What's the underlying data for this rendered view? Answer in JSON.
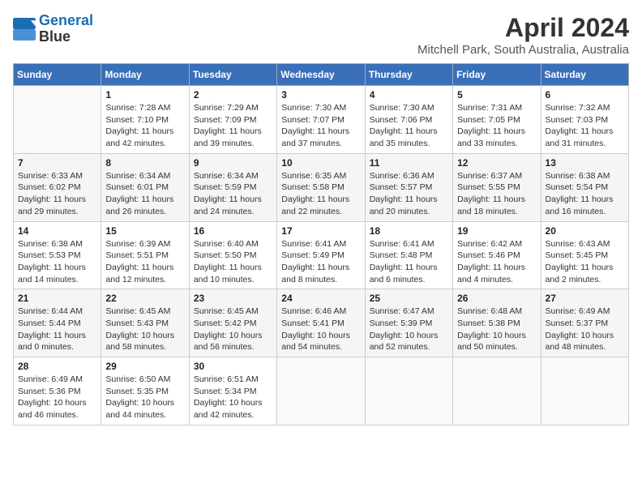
{
  "header": {
    "logo_line1": "General",
    "logo_line2": "Blue",
    "title": "April 2024",
    "subtitle": "Mitchell Park, South Australia, Australia"
  },
  "columns": [
    "Sunday",
    "Monday",
    "Tuesday",
    "Wednesday",
    "Thursday",
    "Friday",
    "Saturday"
  ],
  "weeks": [
    [
      {
        "day": "",
        "info": ""
      },
      {
        "day": "1",
        "info": "Sunrise: 7:28 AM\nSunset: 7:10 PM\nDaylight: 11 hours\nand 42 minutes."
      },
      {
        "day": "2",
        "info": "Sunrise: 7:29 AM\nSunset: 7:09 PM\nDaylight: 11 hours\nand 39 minutes."
      },
      {
        "day": "3",
        "info": "Sunrise: 7:30 AM\nSunset: 7:07 PM\nDaylight: 11 hours\nand 37 minutes."
      },
      {
        "day": "4",
        "info": "Sunrise: 7:30 AM\nSunset: 7:06 PM\nDaylight: 11 hours\nand 35 minutes."
      },
      {
        "day": "5",
        "info": "Sunrise: 7:31 AM\nSunset: 7:05 PM\nDaylight: 11 hours\nand 33 minutes."
      },
      {
        "day": "6",
        "info": "Sunrise: 7:32 AM\nSunset: 7:03 PM\nDaylight: 11 hours\nand 31 minutes."
      }
    ],
    [
      {
        "day": "7",
        "info": "Sunrise: 6:33 AM\nSunset: 6:02 PM\nDaylight: 11 hours\nand 29 minutes."
      },
      {
        "day": "8",
        "info": "Sunrise: 6:34 AM\nSunset: 6:01 PM\nDaylight: 11 hours\nand 26 minutes."
      },
      {
        "day": "9",
        "info": "Sunrise: 6:34 AM\nSunset: 5:59 PM\nDaylight: 11 hours\nand 24 minutes."
      },
      {
        "day": "10",
        "info": "Sunrise: 6:35 AM\nSunset: 5:58 PM\nDaylight: 11 hours\nand 22 minutes."
      },
      {
        "day": "11",
        "info": "Sunrise: 6:36 AM\nSunset: 5:57 PM\nDaylight: 11 hours\nand 20 minutes."
      },
      {
        "day": "12",
        "info": "Sunrise: 6:37 AM\nSunset: 5:55 PM\nDaylight: 11 hours\nand 18 minutes."
      },
      {
        "day": "13",
        "info": "Sunrise: 6:38 AM\nSunset: 5:54 PM\nDaylight: 11 hours\nand 16 minutes."
      }
    ],
    [
      {
        "day": "14",
        "info": "Sunrise: 6:38 AM\nSunset: 5:53 PM\nDaylight: 11 hours\nand 14 minutes."
      },
      {
        "day": "15",
        "info": "Sunrise: 6:39 AM\nSunset: 5:51 PM\nDaylight: 11 hours\nand 12 minutes."
      },
      {
        "day": "16",
        "info": "Sunrise: 6:40 AM\nSunset: 5:50 PM\nDaylight: 11 hours\nand 10 minutes."
      },
      {
        "day": "17",
        "info": "Sunrise: 6:41 AM\nSunset: 5:49 PM\nDaylight: 11 hours\nand 8 minutes."
      },
      {
        "day": "18",
        "info": "Sunrise: 6:41 AM\nSunset: 5:48 PM\nDaylight: 11 hours\nand 6 minutes."
      },
      {
        "day": "19",
        "info": "Sunrise: 6:42 AM\nSunset: 5:46 PM\nDaylight: 11 hours\nand 4 minutes."
      },
      {
        "day": "20",
        "info": "Sunrise: 6:43 AM\nSunset: 5:45 PM\nDaylight: 11 hours\nand 2 minutes."
      }
    ],
    [
      {
        "day": "21",
        "info": "Sunrise: 6:44 AM\nSunset: 5:44 PM\nDaylight: 11 hours\nand 0 minutes."
      },
      {
        "day": "22",
        "info": "Sunrise: 6:45 AM\nSunset: 5:43 PM\nDaylight: 10 hours\nand 58 minutes."
      },
      {
        "day": "23",
        "info": "Sunrise: 6:45 AM\nSunset: 5:42 PM\nDaylight: 10 hours\nand 56 minutes."
      },
      {
        "day": "24",
        "info": "Sunrise: 6:46 AM\nSunset: 5:41 PM\nDaylight: 10 hours\nand 54 minutes."
      },
      {
        "day": "25",
        "info": "Sunrise: 6:47 AM\nSunset: 5:39 PM\nDaylight: 10 hours\nand 52 minutes."
      },
      {
        "day": "26",
        "info": "Sunrise: 6:48 AM\nSunset: 5:38 PM\nDaylight: 10 hours\nand 50 minutes."
      },
      {
        "day": "27",
        "info": "Sunrise: 6:49 AM\nSunset: 5:37 PM\nDaylight: 10 hours\nand 48 minutes."
      }
    ],
    [
      {
        "day": "28",
        "info": "Sunrise: 6:49 AM\nSunset: 5:36 PM\nDaylight: 10 hours\nand 46 minutes."
      },
      {
        "day": "29",
        "info": "Sunrise: 6:50 AM\nSunset: 5:35 PM\nDaylight: 10 hours\nand 44 minutes."
      },
      {
        "day": "30",
        "info": "Sunrise: 6:51 AM\nSunset: 5:34 PM\nDaylight: 10 hours\nand 42 minutes."
      },
      {
        "day": "",
        "info": ""
      },
      {
        "day": "",
        "info": ""
      },
      {
        "day": "",
        "info": ""
      },
      {
        "day": "",
        "info": ""
      }
    ]
  ]
}
